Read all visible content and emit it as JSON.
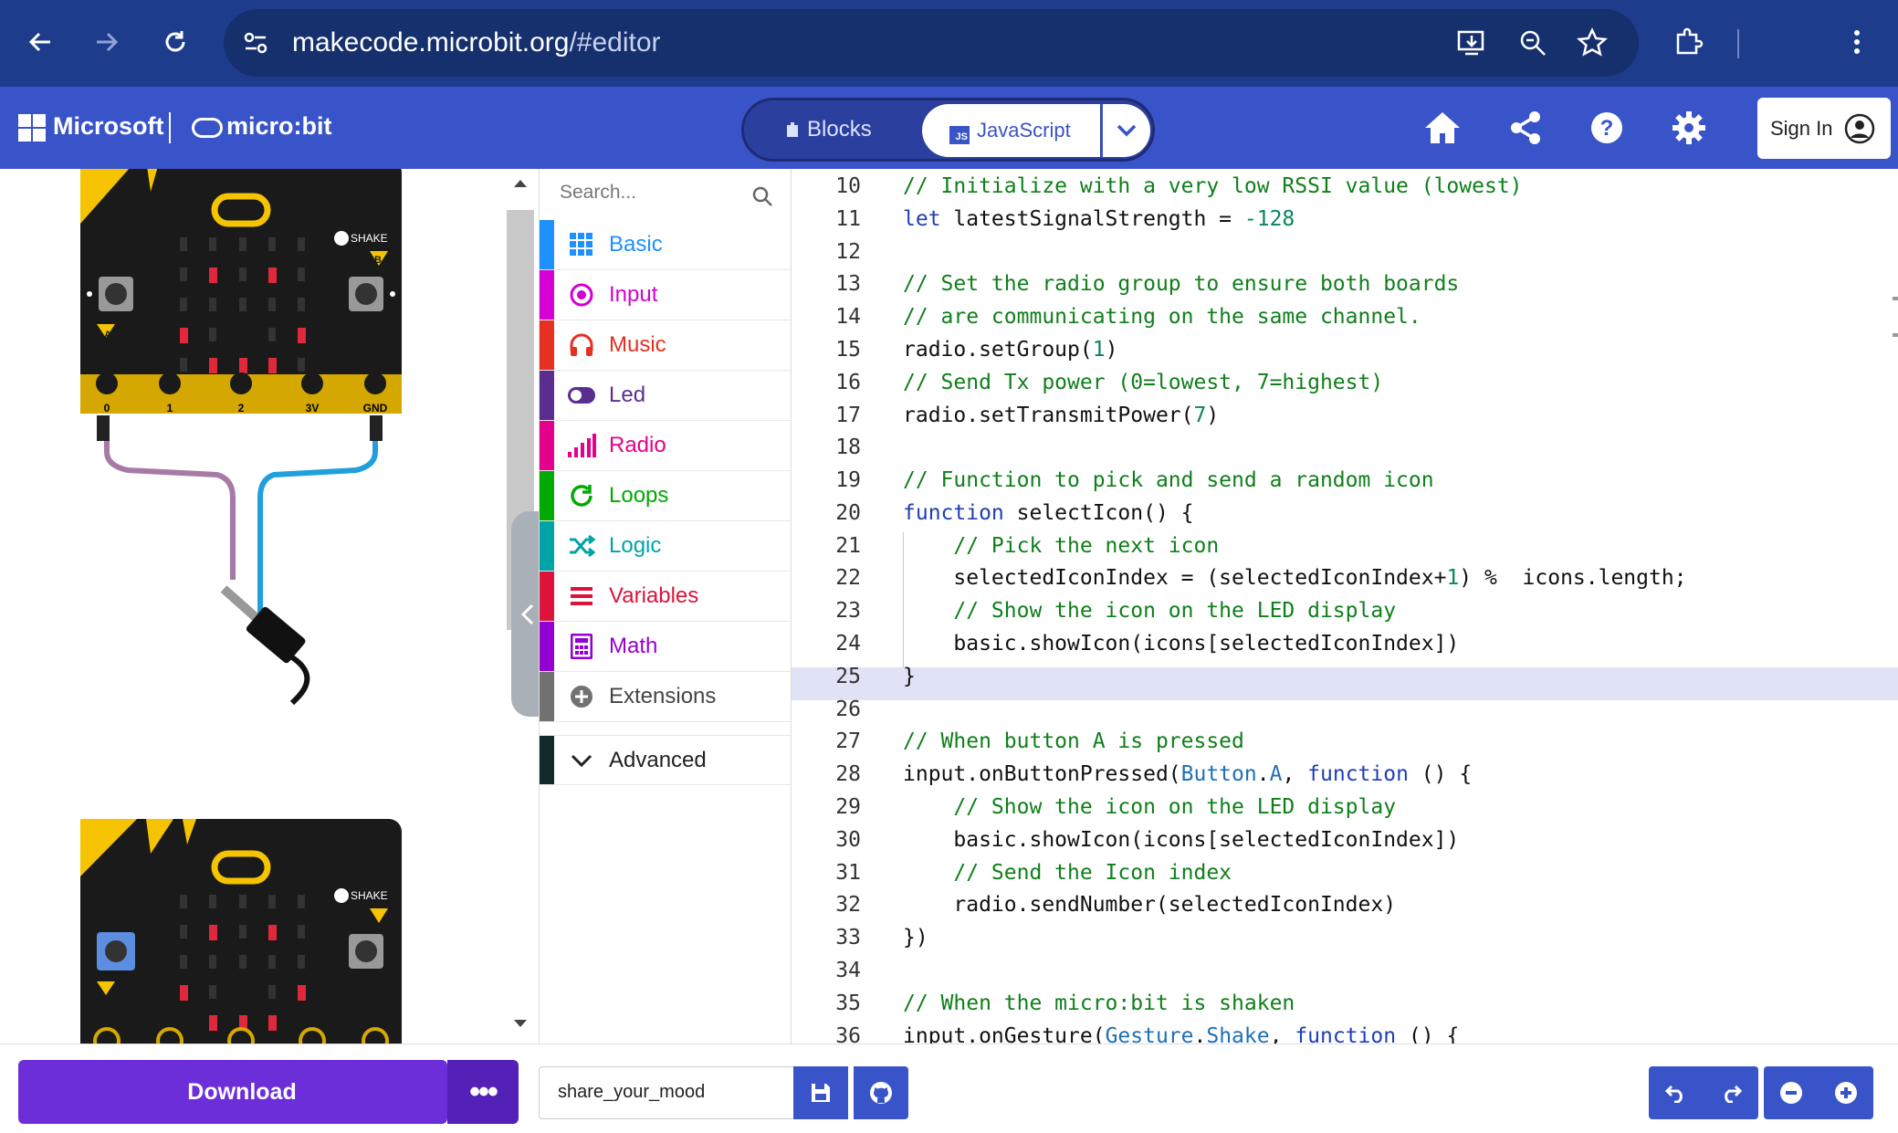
{
  "browser": {
    "url_host": "makecode.microbit.org",
    "url_path": "/#editor"
  },
  "header": {
    "brand": "Microsoft",
    "product": "micro:bit",
    "blocks_label": "Blocks",
    "javascript_label": "JavaScript",
    "js_badge": "JS",
    "signin_label": "Sign In"
  },
  "simulator": {
    "pin_labels": [
      "0",
      "1",
      "2",
      "3V",
      "GND"
    ],
    "button_a": "A",
    "button_b": "B",
    "shake_label": "SHAKE"
  },
  "toolbox": {
    "search_placeholder": "Search...",
    "categories": [
      {
        "label": "Basic",
        "color": "#1e90ff"
      },
      {
        "label": "Input",
        "color": "#d400d4"
      },
      {
        "label": "Music",
        "color": "#e63022"
      },
      {
        "label": "Led",
        "color": "#5c2d91"
      },
      {
        "label": "Radio",
        "color": "#e3008c"
      },
      {
        "label": "Loops",
        "color": "#00aa00"
      },
      {
        "label": "Logic",
        "color": "#00a4a6"
      },
      {
        "label": "Variables",
        "color": "#dc143c"
      },
      {
        "label": "Math",
        "color": "#9400d3"
      },
      {
        "label": "Extensions",
        "color": "#717171"
      }
    ],
    "advanced_label": "Advanced"
  },
  "editor": {
    "lines": [
      {
        "n": "10",
        "code": "// Initialize with a very low RSSI value (lowest)"
      },
      {
        "n": "11",
        "code": "let latestSignalStrength = -128"
      },
      {
        "n": "12",
        "code": ""
      },
      {
        "n": "13",
        "code": "// Set the radio group to ensure both boards"
      },
      {
        "n": "14",
        "code": "// are communicating on the same channel."
      },
      {
        "n": "15",
        "code": "radio.setGroup(1)"
      },
      {
        "n": "16",
        "code": "// Send Tx power (0=lowest, 7=highest)"
      },
      {
        "n": "17",
        "code": "radio.setTransmitPower(7)"
      },
      {
        "n": "18",
        "code": ""
      },
      {
        "n": "19",
        "code": "// Function to pick and send a random icon"
      },
      {
        "n": "20",
        "code": "function selectIcon() {"
      },
      {
        "n": "21",
        "code": "    // Pick the next icon"
      },
      {
        "n": "22",
        "code": "    selectedIconIndex = (selectedIconIndex+1) %  icons.length;"
      },
      {
        "n": "23",
        "code": "    // Show the icon on the LED display"
      },
      {
        "n": "24",
        "code": "    basic.showIcon(icons[selectedIconIndex])"
      },
      {
        "n": "25",
        "code": "}"
      },
      {
        "n": "26",
        "code": ""
      },
      {
        "n": "27",
        "code": "// When button A is pressed"
      },
      {
        "n": "28",
        "code": "input.onButtonPressed(Button.A, function () {"
      },
      {
        "n": "29",
        "code": "    // Show the icon on the LED display"
      },
      {
        "n": "30",
        "code": "    basic.showIcon(icons[selectedIconIndex])"
      },
      {
        "n": "31",
        "code": "    // Send the Icon index"
      },
      {
        "n": "32",
        "code": "    radio.sendNumber(selectedIconIndex)"
      },
      {
        "n": "33",
        "code": "})"
      },
      {
        "n": "34",
        "code": ""
      },
      {
        "n": "35",
        "code": "// When the micro:bit is shaken"
      },
      {
        "n": "36",
        "code": "input.onGesture(Gesture.Shake, function () {"
      }
    ]
  },
  "footer": {
    "download_label": "Download",
    "more_label": "•••",
    "project_name": "share_your_mood"
  }
}
